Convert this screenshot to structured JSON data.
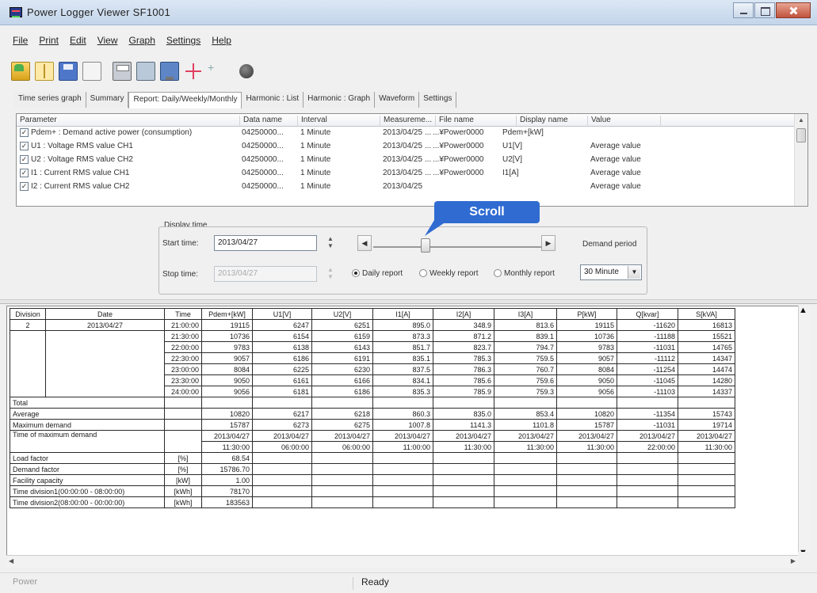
{
  "window": {
    "title": "Power Logger Viewer SF1001"
  },
  "menu": [
    "File",
    "Print",
    "Edit",
    "View",
    "Graph",
    "Settings",
    "Help"
  ],
  "toolbar": {
    "icons": [
      "open-folder-icon",
      "open-book-icon",
      "save-icon",
      "copy-document-icon",
      "print-icon",
      "print-preview-icon",
      "monitor-icon",
      "cursor-move-icon",
      "add-icon",
      "help-icon"
    ]
  },
  "tabs": [
    {
      "label": "Time series graph",
      "active": false
    },
    {
      "label": "Summary",
      "active": false
    },
    {
      "label": "Report: Daily/Weekly/Monthly",
      "active": true
    },
    {
      "label": "Harmonic : List",
      "active": false
    },
    {
      "label": "Harmonic : Graph",
      "active": false
    },
    {
      "label": "Waveform",
      "active": false
    },
    {
      "label": "Settings",
      "active": false
    }
  ],
  "param_list": {
    "headers": [
      "Parameter",
      "Data name",
      "Interval",
      "Measureme...",
      "File name",
      "Display name",
      "Value"
    ],
    "rows": [
      {
        "checked": "✓",
        "parameter": "Pdem+ : Demand active power (consumption)",
        "data_name": "04250000...",
        "interval": "1 Minute",
        "measure": "2013/04/25 ...",
        "file": "...¥Power0000",
        "display": "Pdem+[kW]",
        "value": ""
      },
      {
        "checked": "✓",
        "parameter": "U1 : Voltage RMS value CH1",
        "data_name": "04250000...",
        "interval": "1 Minute",
        "measure": "2013/04/25 ...",
        "file": "...¥Power0000",
        "display": "U1[V]",
        "value": "Average value"
      },
      {
        "checked": "✓",
        "parameter": "U2 : Voltage RMS value CH2",
        "data_name": "04250000...",
        "interval": "1 Minute",
        "measure": "2013/04/25 ...",
        "file": "...¥Power0000",
        "display": "U2[V]",
        "value": "Average value"
      },
      {
        "checked": "✓",
        "parameter": "I1 : Current RMS value CH1",
        "data_name": "04250000...",
        "interval": "1 Minute",
        "measure": "2013/04/25 ...",
        "file": "...¥Power0000",
        "display": "I1[A]",
        "value": "Average value"
      },
      {
        "checked": "✓",
        "parameter": "I2 : Current RMS value CH2",
        "data_name": "04250000...",
        "interval": "1 Minute",
        "measure": "2013/04/25",
        "file": "",
        "display": "",
        "value": "Average value"
      }
    ]
  },
  "display_time": {
    "legend": "Display time",
    "start_label": "Start time:",
    "start_value": "2013/04/27",
    "stop_label": "Stop time:",
    "stop_value": "2013/04/27",
    "report_types": [
      {
        "label": "Daily report",
        "selected": true
      },
      {
        "label": "Weekly report",
        "selected": false
      },
      {
        "label": "Monthly report",
        "selected": false
      }
    ],
    "demand_label": "Demand period",
    "demand_value": "30 Minute"
  },
  "callout": {
    "label": "Scroll"
  },
  "report": {
    "headers": [
      "Division",
      "Date",
      "Time",
      "Pdem+[kW]",
      "U1[V]",
      "U2[V]",
      "I1[A]",
      "I2[A]",
      "I3[A]",
      "P[kW]",
      "Q[kvar]",
      "S[kVA]"
    ],
    "division": "2",
    "date": "2013/04/27",
    "time_rows": [
      [
        "21:00:00",
        "19115",
        "6247",
        "6251",
        "895.0",
        "348.9",
        "813.6",
        "19115",
        "-11620",
        "16813"
      ],
      [
        "21:30:00",
        "10736",
        "6154",
        "6159",
        "873.3",
        "871.2",
        "839.1",
        "10736",
        "-11188",
        "15521"
      ],
      [
        "22:00:00",
        "9783",
        "6138",
        "6143",
        "851.7",
        "823.7",
        "794.7",
        "9783",
        "-11031",
        "14765"
      ],
      [
        "22:30:00",
        "9057",
        "6186",
        "6191",
        "835.1",
        "785.3",
        "759.5",
        "9057",
        "-11112",
        "14347"
      ],
      [
        "23:00:00",
        "8084",
        "6225",
        "6230",
        "837.5",
        "786.3",
        "760.7",
        "8084",
        "-11254",
        "14474"
      ],
      [
        "23:30:00",
        "9050",
        "6161",
        "6166",
        "834.1",
        "785.6",
        "759.6",
        "9050",
        "-11045",
        "14280"
      ],
      [
        "24:00:00",
        "9056",
        "6181",
        "6186",
        "835.3",
        "785.9",
        "759.3",
        "9056",
        "-11103",
        "14337"
      ]
    ],
    "total_label": "Total",
    "average_label": "Average",
    "average": [
      "10820",
      "6217",
      "6218",
      "860.3",
      "835.0",
      "853.4",
      "10820",
      "-11354",
      "15743"
    ],
    "max_demand_label": "Maximum demand",
    "max_demand": [
      "15787",
      "6273",
      "6275",
      "1007.8",
      "1141.3",
      "1101.8",
      "15787",
      "-11031",
      "19714"
    ],
    "time_max_label": "Time of maximum demand",
    "time_max_dates": [
      "2013/04/27",
      "2013/04/27",
      "2013/04/27",
      "2013/04/27",
      "2013/04/27",
      "2013/04/27",
      "2013/04/27",
      "2013/04/27",
      "2013/04/27"
    ],
    "time_max_times": [
      "11:30:00",
      "06:00:00",
      "06:00:00",
      "11:00:00",
      "11:30:00",
      "11:30:00",
      "11:30:00",
      "22:00:00",
      "11:30:00"
    ],
    "extras": [
      {
        "label": "Load factor",
        "unit": "[%]",
        "value": "68.54"
      },
      {
        "label": "Demand factor",
        "unit": "[%]",
        "value": "15786.70"
      },
      {
        "label": "Facility capacity",
        "unit": "[kW]",
        "value": "1.00"
      },
      {
        "label": "Time division1(00:00:00 - 08:00:00)",
        "unit": "[kWh]",
        "value": "78170"
      },
      {
        "label": "Time division2(08:00:00 - 00:00:00)",
        "unit": "[kWh]",
        "value": "183563"
      }
    ]
  },
  "status": {
    "left": "Power",
    "center": "Ready"
  }
}
